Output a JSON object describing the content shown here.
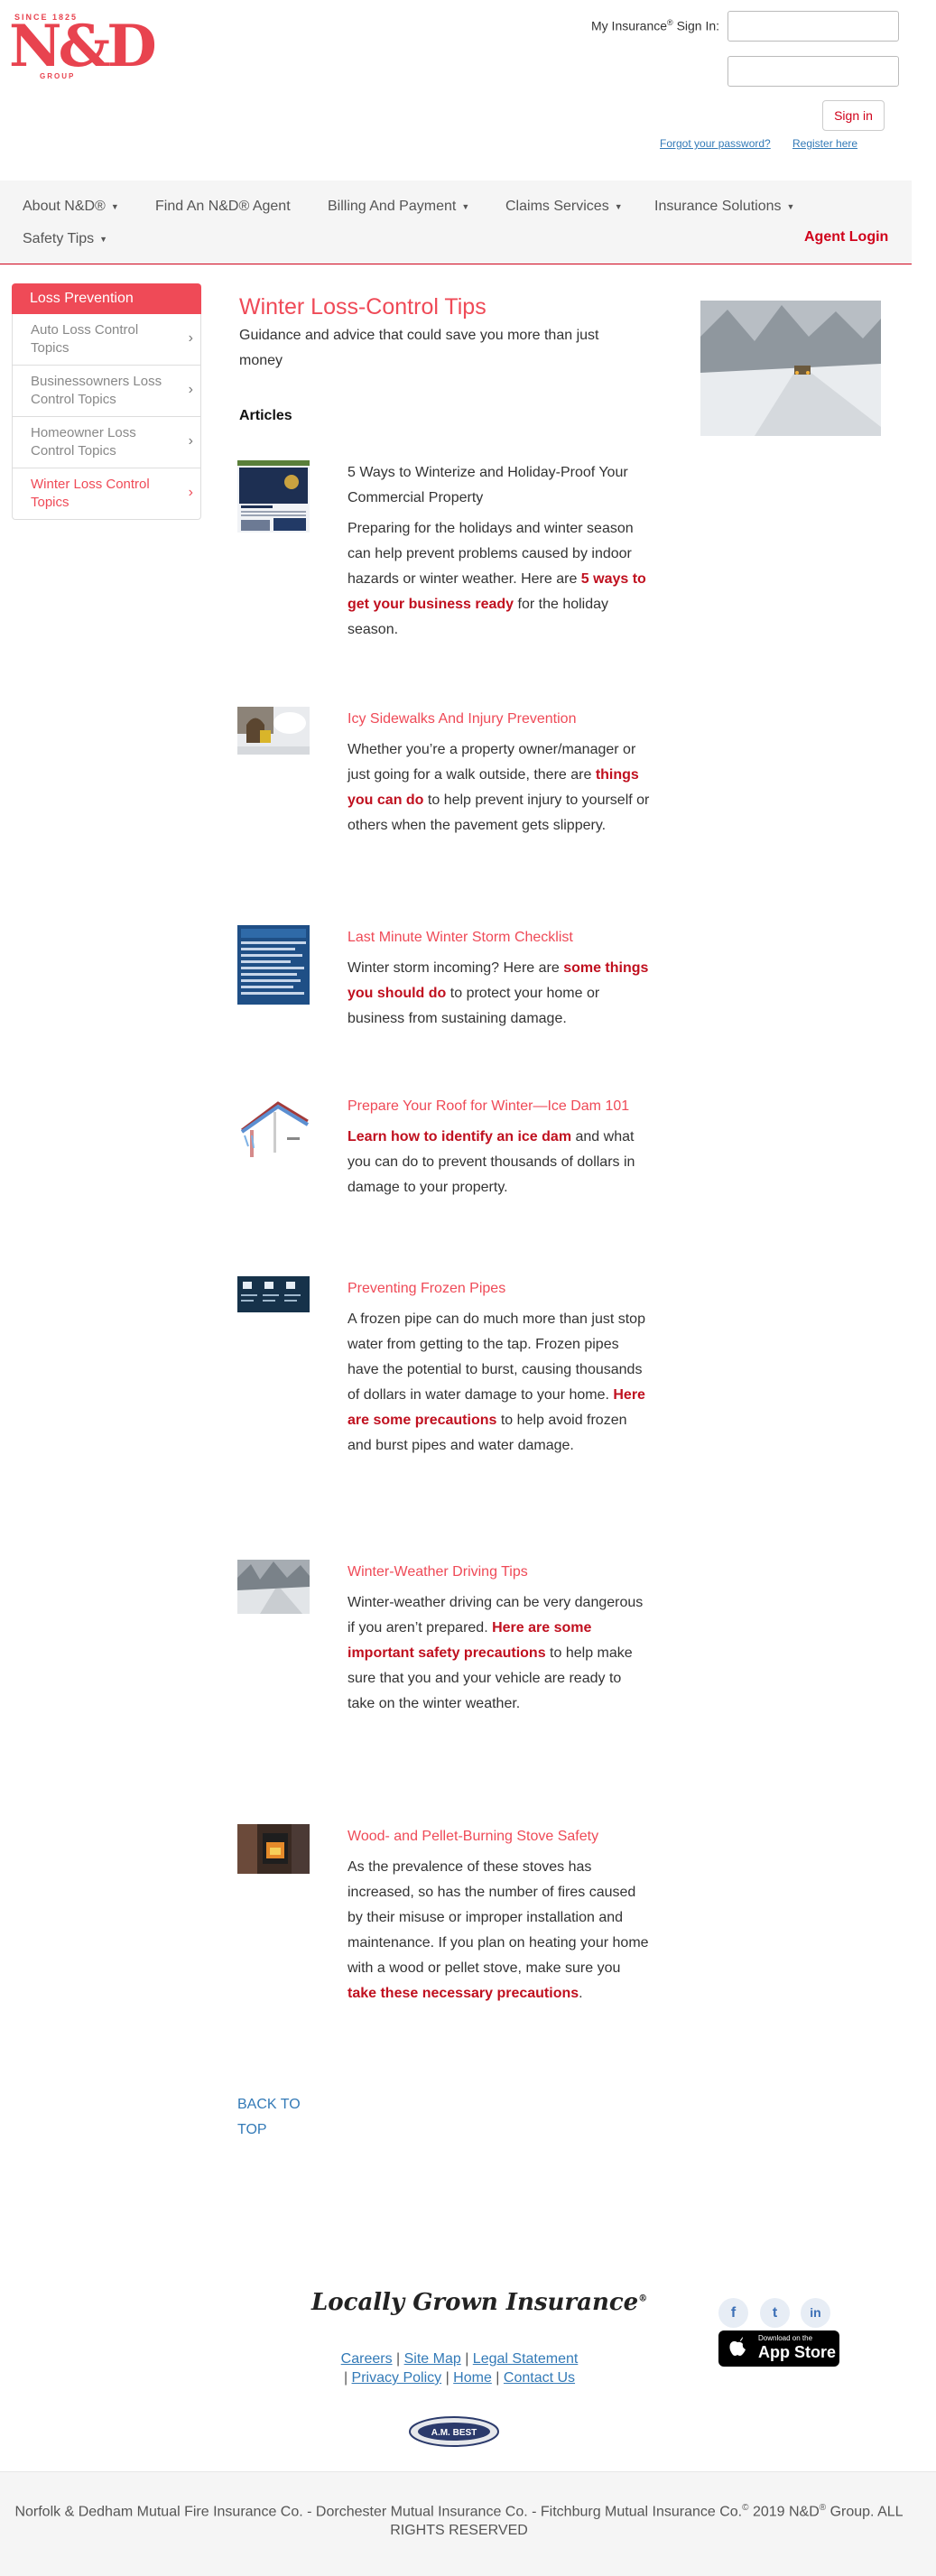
{
  "header": {
    "logo_since": "SINCE 1825",
    "logo_mark": "N&D",
    "logo_group": "GROUP",
    "signin_label_prefix": "My Insurance",
    "signin_label_reg": "®",
    "signin_label_suffix": " Sign In:",
    "username_value": "",
    "password_value": "",
    "signin_button": "Sign in",
    "forgot_password": "Forgot your password?",
    "register": "Register here"
  },
  "nav": {
    "items": [
      {
        "label": "About N&D®",
        "dropdown": true
      },
      {
        "label": "Find An N&D® Agent",
        "dropdown": false
      },
      {
        "label": "Billing And Payment",
        "dropdown": true
      },
      {
        "label": "Claims Services",
        "dropdown": true
      },
      {
        "label": "Insurance Solutions",
        "dropdown": true
      },
      {
        "label": "Safety Tips",
        "dropdown": true
      }
    ],
    "caret": "▼",
    "agent_login": "Agent Login"
  },
  "sidebar": {
    "heading": "Loss Prevention",
    "items": [
      {
        "label": "Auto Loss Control Topics",
        "active": false
      },
      {
        "label": "Businessowners Loss Control Topics",
        "active": false
      },
      {
        "label": "Homeowner Loss Control Topics",
        "active": false
      },
      {
        "label": "Winter Loss Control Topics",
        "active": true
      }
    ],
    "chevron": "›"
  },
  "main": {
    "title": "Winter Loss-Control Tips",
    "subtitle": "Guidance and advice that could save you more than just money",
    "articles_heading": "Articles",
    "articles": [
      {
        "title": "5 Ways to Winterize and Holiday-Proof Your Commercial Property",
        "text_before": "Preparing for the holidays and winter season can help prevent problems caused by indoor hazards or winter weather. Here are ",
        "link": "5 ways to get your business ready",
        "text_after": " for the holiday season."
      },
      {
        "title": "Icy Sidewalks And Injury Prevention",
        "text_before": "Whether you’re a property owner/manager or just going for a walk outside, there are ",
        "link": "things you can do",
        "text_after": " to help prevent injury to yourself or others when the pavement gets slippery."
      },
      {
        "title": "Last Minute Winter Storm Checklist",
        "text_before": "Winter storm incoming? Here are ",
        "link": "some things you should do",
        "text_after": " to protect your home or business from sustaining damage."
      },
      {
        "title": "Prepare Your Roof for Winter—Ice Dam 101",
        "text_before": "",
        "link": "Learn how to identify an ice dam",
        "text_after": " and what you can do to prevent thousands of dollars in damage to your property."
      },
      {
        "title": "Preventing Frozen Pipes",
        "text_before": "A frozen pipe can do much more than just stop water from getting to the tap. Frozen pipes have the potential to burst, causing thousands of dollars in water damage to your home. ",
        "link": "Here are some precautions",
        "text_after": " to help avoid frozen and burst pipes and water damage."
      },
      {
        "title": "Winter-Weather Driving Tips",
        "text_before": "Winter-weather driving can be very dangerous if you aren’t prepared.  ",
        "link": "Here are some important safety precautions",
        "text_after": " to help make sure that you and your vehicle are ready to take on the winter weather."
      },
      {
        "title": "Wood- and Pellet-Burning Stove Safety",
        "text_before": "As the prevalence of these stoves has increased, so has the number of fires caused by their misuse or improper installation and maintenance. If you plan on heating your home with a wood or pellet stove, make sure you ",
        "link": "take these necessary precautions",
        "text_after": "."
      }
    ],
    "back_to_top": "BACK TO TOP"
  },
  "footer": {
    "tagline": "Locally Grown Insurance",
    "tagline_reg": "®",
    "social": [
      "f",
      "t",
      "in"
    ],
    "appstore_small": "Download on the",
    "appstore_big": "App Store",
    "links": [
      "Careers",
      "Site Map",
      "Legal Statement",
      "Privacy Policy",
      "Home",
      "Contact Us"
    ],
    "ambest": "A.M. BEST",
    "copyright_before": "Norfolk & Dedham Mutual Fire Insurance Co. - Dorchester Mutual Insurance Co. - Fitchburg Mutual Insurance Co.",
    "copyright_symbol": "©",
    "copyright_after": " 2019 N&D",
    "copyright_reg": "®",
    "copyright_end": " Group. ALL RIGHTS RESERVED"
  },
  "colors": {
    "brand_red": "#ef4a57",
    "link_red": "#c0101f",
    "link_blue": "#337ab7"
  }
}
